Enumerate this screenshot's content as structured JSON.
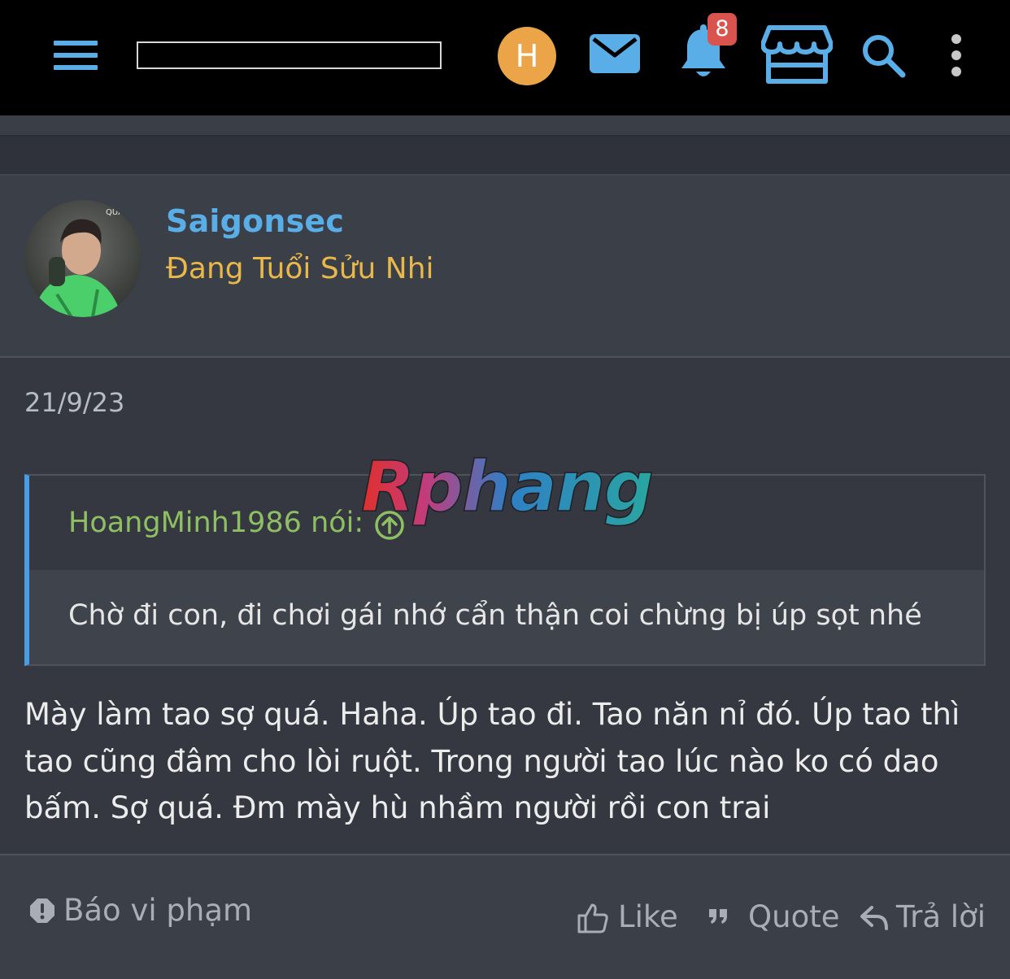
{
  "topbar": {
    "avatar_letter": "H",
    "notification_count": "8",
    "colors": {
      "accent": "#5aaee8",
      "avatar_bg": "#eba448",
      "badge": "#d9534f"
    }
  },
  "post": {
    "username": "Saigonsec",
    "user_title": "Đang Tuổi Sửu Nhi",
    "date": "21/9/23",
    "quote": {
      "author": "HoangMinh1986 nói:",
      "text": "Chờ đi con, đi chơi gái nhớ cẩn thận coi chừng bị úp sọt nhé"
    },
    "message": "Mày làm tao sợ quá. Haha. Úp tao đi. Tao năn nỉ đó. Úp tao thì tao cũng đâm cho lòi ruột. Trong người tao lúc nào ko có dao bấm. Sợ quá. Đm mày hù nhầm người rồi con trai",
    "watermark": "Rphang"
  },
  "footer": {
    "report_label": "Báo vi phạm",
    "like_label": "Like",
    "quote_label": "Quote",
    "reply_label": "Trả lời"
  }
}
